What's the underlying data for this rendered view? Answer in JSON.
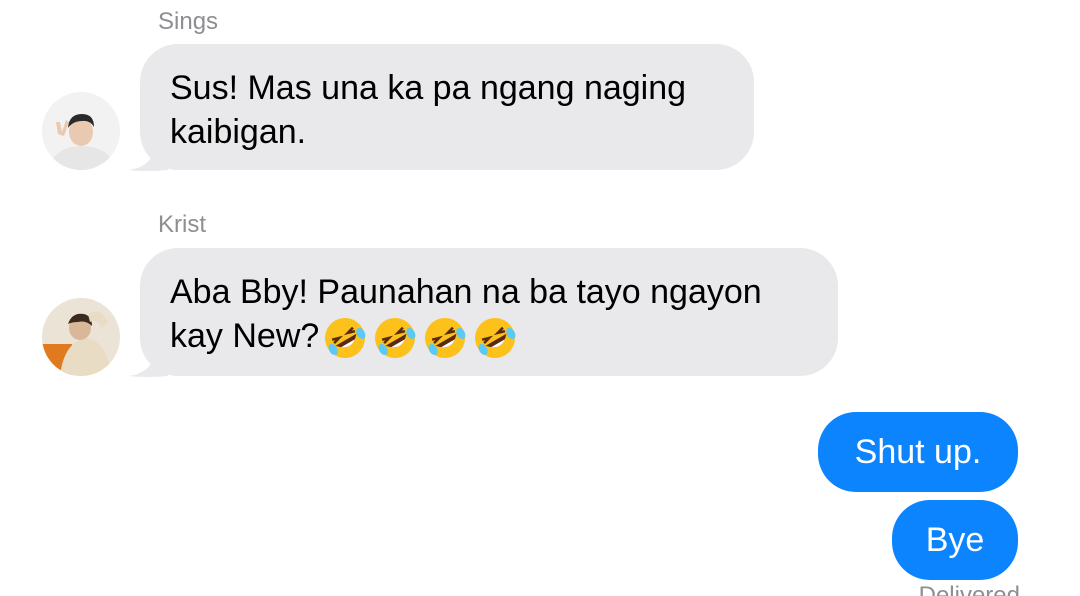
{
  "conversation": {
    "messages": [
      {
        "sender": "Sings",
        "direction": "incoming",
        "lines": [
          "Sus! Mas una ka pa ngang naging",
          "kaibigan."
        ]
      },
      {
        "sender": "Krist",
        "direction": "incoming",
        "lines": [
          "Aba Bby! Paunahan na ba tayo ngayon",
          "kay New?"
        ],
        "emoji_count": 4,
        "emoji_icon": "rolling-on-floor-laughing-emoji"
      },
      {
        "direction": "outgoing",
        "text": "Shut up."
      },
      {
        "direction": "outgoing",
        "text": "Bye"
      }
    ],
    "status": "Delivered"
  },
  "colors": {
    "incoming_bubble": "#e9e9eb",
    "outgoing_bubble": "#0b84fe",
    "sender_name": "#8e8e93"
  }
}
